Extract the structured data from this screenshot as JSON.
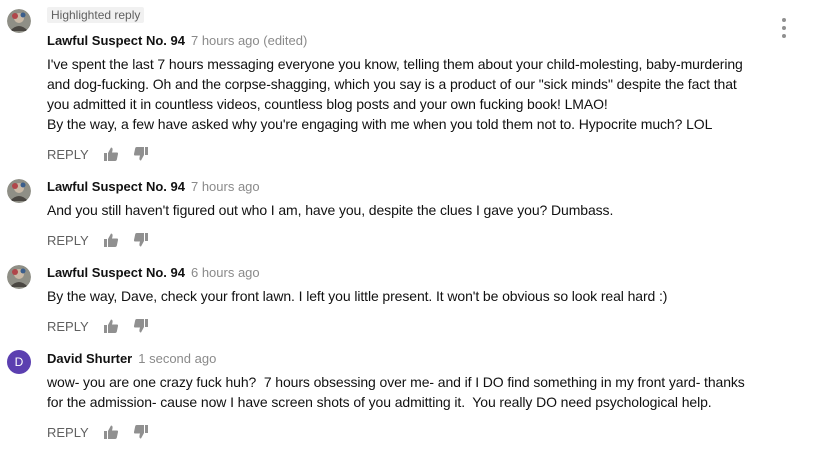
{
  "highlight_badge": "Highlighted reply",
  "menu_icon": "more-vert-icon",
  "avatar_color": "#5b3fb0",
  "comments": [
    {
      "author": "Lawful Suspect No. 94",
      "time": "7 hours ago (edited)",
      "text": "I've spent the last 7 hours messaging everyone you know, telling them about your child-molesting, baby-murdering\nand dog-fucking. Oh and the corpse-shagging, which you say is a product of our \"sick minds\" despite the fact that\nyou admitted it in countless videos, countless blog posts and your own fucking book! LMAO!\nBy the way, a few have asked why you're engaging with me when you told them not to. Hypocrite much? LOL",
      "reply_label": "REPLY"
    },
    {
      "author": "Lawful Suspect No. 94",
      "time": "7 hours ago",
      "text": "And you still haven't figured out who I am, have you, despite the clues I gave you? Dumbass.",
      "reply_label": "REPLY"
    },
    {
      "author": "Lawful Suspect No. 94",
      "time": "6 hours ago",
      "text": "By the way, Dave, check your front lawn. I left you little present. It won't be obvious so look real hard :)",
      "reply_label": "REPLY"
    },
    {
      "author": "David Shurter",
      "time": "1 second ago",
      "avatar_letter": "D",
      "text": "wow- you are one crazy fuck huh?  7 hours obsessing over me- and if I DO find something in my front yard- thanks\nfor the admission- cause now I have screen shots of you admitting it.  You really DO need psychological help.",
      "reply_label": "REPLY"
    }
  ]
}
